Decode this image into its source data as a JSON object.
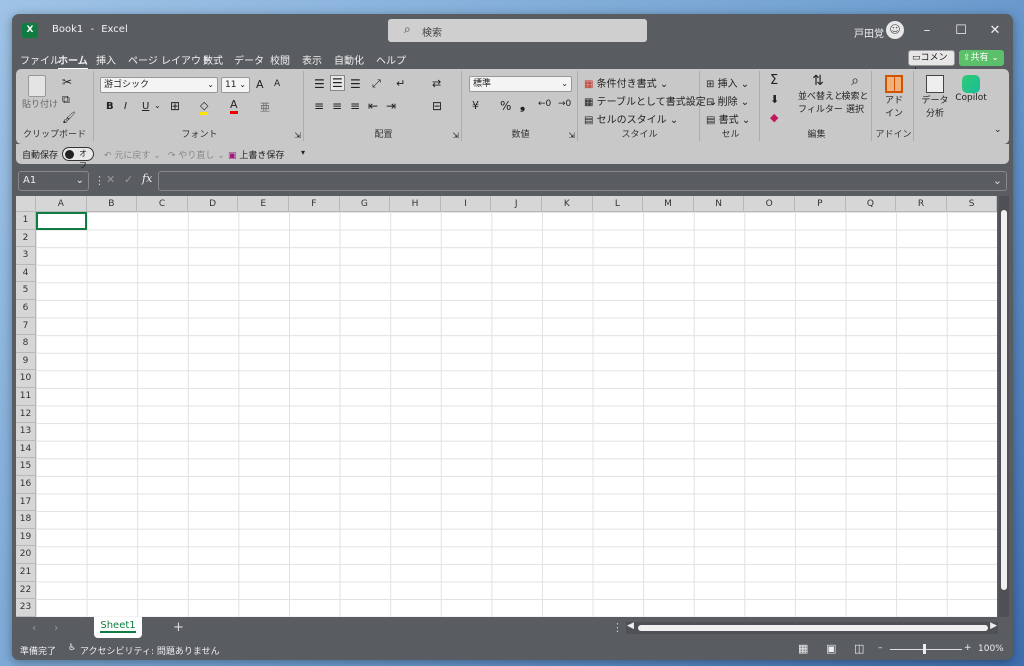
{
  "title": {
    "file": "Book1",
    "sep": "-",
    "app": "Excel"
  },
  "search": {
    "placeholder": "検索"
  },
  "user": {
    "name": "戸田覚"
  },
  "window_controls": {
    "minimize": "–",
    "maximize": "☐",
    "close": "✕"
  },
  "menu": {
    "items": [
      "ファイル",
      "ホーム",
      "挿入",
      "ページ レイアウト",
      "数式",
      "データ",
      "校閲",
      "表示",
      "自動化",
      "ヘルプ"
    ],
    "active": "ホーム",
    "comment_label": "コメント",
    "share_label": "共有"
  },
  "ribbon": {
    "clipboard": {
      "label": "クリップボード",
      "paste": "貼り付け"
    },
    "font": {
      "label": "フォント",
      "name": "游ゴシック",
      "size": "11",
      "bold": "B",
      "italic": "I",
      "underline": "U",
      "grow": "A",
      "shrink": "A"
    },
    "alignment": {
      "label": "配置"
    },
    "number": {
      "label": "数値",
      "format": "標準",
      "percent": "%",
      "comma": "❟"
    },
    "styles": {
      "label": "スタイル",
      "conditional": "条件付き書式",
      "table": "テーブルとして書式設定",
      "cell_styles": "セルのスタイル"
    },
    "cells": {
      "label": "セル",
      "insert": "挿入",
      "delete": "削除",
      "format": "書式"
    },
    "editing": {
      "label": "編集",
      "sort": [
        "並べ替えと",
        "フィルター"
      ],
      "find": [
        "検索と",
        "選択"
      ],
      "sum": "Σ"
    },
    "addins": {
      "label": "アドイン",
      "button": [
        "アド",
        "イン"
      ]
    },
    "analysis": {
      "button": [
        "データ",
        "分析"
      ]
    },
    "copilot": {
      "button": "Copilot"
    }
  },
  "qat": {
    "autosave": "自動保存",
    "toggle": "オフ",
    "undo": "元に戻す",
    "redo": "やり直し",
    "save": "上書き保存"
  },
  "formula": {
    "namebox": "A1",
    "fx": "fx"
  },
  "columns": [
    "A",
    "B",
    "C",
    "D",
    "E",
    "F",
    "G",
    "H",
    "I",
    "J",
    "K",
    "L",
    "M",
    "N",
    "O",
    "P",
    "Q",
    "R",
    "S"
  ],
  "rows": [
    "1",
    "2",
    "3",
    "4",
    "5",
    "6",
    "7",
    "8",
    "9",
    "10",
    "11",
    "12",
    "13",
    "14",
    "15",
    "16",
    "17",
    "18",
    "19",
    "20",
    "21",
    "22",
    "23"
  ],
  "sheets": {
    "tabs": [
      "Sheet1"
    ],
    "add": "+"
  },
  "status": {
    "ready": "準備完了",
    "accessibility": "アクセシビリティ: 問題ありません",
    "zoom": "100%",
    "zoom_minus": "–",
    "zoom_plus": "+"
  },
  "colors": {
    "excel_green": "#107c41",
    "chrome": "#595c61",
    "ribbon": "#c8c8c8",
    "share": "#5cbf6a"
  }
}
